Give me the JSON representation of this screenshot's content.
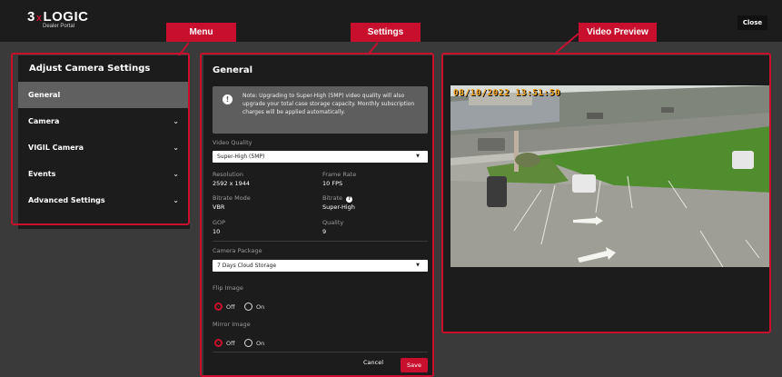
{
  "app": {
    "brand": "LOGIC",
    "brand_prefix": "3",
    "brand_x": "x",
    "subtitle": "Dealer Portal",
    "close_label": "Close"
  },
  "callouts": {
    "menu": "Menu",
    "settings": "Settings",
    "video_preview": "Video Preview"
  },
  "menu": {
    "title": "Adjust Camera Settings",
    "items": [
      {
        "label": "General",
        "active": true
      },
      {
        "label": "Camera",
        "active": false
      },
      {
        "label": "VIGIL Camera",
        "active": false
      },
      {
        "label": "Events",
        "active": false
      },
      {
        "label": "Advanced Settings",
        "active": false
      }
    ]
  },
  "settings": {
    "title": "General",
    "note": "Note: Upgrading to Super-High (5MP) video quality will also upgrade your total case storage capacity. Monthly subscription charges will be applied automatically.",
    "video_quality_label": "Video Quality",
    "video_quality_value": "Super-High (5MP)",
    "resolution_label": "Resolution",
    "resolution_value": "2592 x 1944",
    "frame_rate_label": "Frame Rate",
    "frame_rate_value": "10 FPS",
    "bitrate_mode_label": "Bitrate Mode",
    "bitrate_mode_value": "VBR",
    "bitrate_label": "Bitrate",
    "bitrate_value": "Super-High",
    "gop_label": "GOP",
    "gop_value": "10",
    "quality_label": "Quality",
    "quality_value": "9",
    "camera_package_label": "Camera Package",
    "camera_package_value": "7 Days Cloud Storage",
    "flip_image_label": "Flip Image",
    "mirror_image_label": "Mirror Image",
    "off_label": "Off",
    "on_label": "On",
    "flip_selected": "Off",
    "mirror_selected": "Off",
    "cancel_label": "Cancel",
    "save_label": "Save"
  },
  "video": {
    "timestamp": "08/10/2022 13:51:50"
  },
  "colors": {
    "accent": "#c8102e",
    "panel": "#1c1c1c",
    "background": "#3a3a3a"
  }
}
